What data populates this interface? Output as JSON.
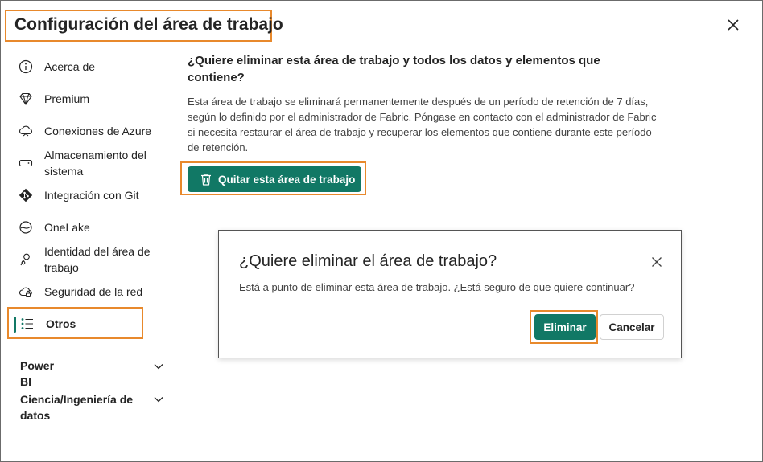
{
  "panel": {
    "title": "Configuración del área de trabajo"
  },
  "sidebar": {
    "items": [
      {
        "label": "Acerca de",
        "icon": "info-icon"
      },
      {
        "label": "Premium",
        "icon": "diamond-icon"
      },
      {
        "label": "Conexiones de Azure",
        "icon": "cloud-link-icon"
      },
      {
        "label": "Almacenamiento del sistema",
        "icon": "storage-icon"
      },
      {
        "label": "Integración con Git",
        "icon": "git-icon"
      },
      {
        "label": "OneLake",
        "icon": "onelake-icon"
      },
      {
        "label": "Identidad del área de trabajo",
        "icon": "identity-icon"
      },
      {
        "label": "Seguridad de la red",
        "icon": "cloud-lock-icon"
      },
      {
        "label": "Otros",
        "icon": "list-icon",
        "selected": true
      }
    ],
    "sections": [
      {
        "label": "Power BI"
      },
      {
        "label": "Ciencia/Ingeniería de datos"
      }
    ]
  },
  "main": {
    "heading": "¿Quiere eliminar esta área de trabajo y todos los datos y elementos que contiene?",
    "description": "Esta área de trabajo se eliminará permanentemente después de un período de retención de 7 días, según lo definido por el administrador de Fabric. Póngase en contacto con el administrador de Fabric si necesita restaurar el área de trabajo y recuperar los elementos que contiene durante este período de retención.",
    "delete_button": "Quitar esta área de trabajo"
  },
  "dialog": {
    "title": "¿Quiere eliminar el área de trabajo?",
    "message": "Está a punto de eliminar esta área de trabajo. ¿Está seguro de que quiere continuar?",
    "confirm": "Eliminar",
    "cancel": "Cancelar"
  },
  "colors": {
    "accent": "#117865",
    "highlight": "#e8892c"
  }
}
